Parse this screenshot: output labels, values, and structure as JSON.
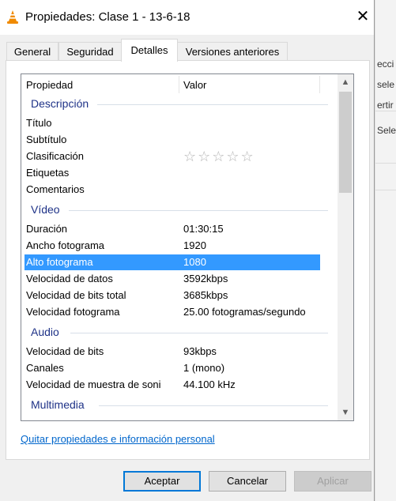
{
  "window": {
    "title": "Propiedades: Clase 1 - 13-6-18",
    "close_glyph": "✕"
  },
  "tabs": [
    {
      "label": "General"
    },
    {
      "label": "Seguridad"
    },
    {
      "label": "Detalles",
      "active": true
    },
    {
      "label": "Versiones anteriores"
    }
  ],
  "list": {
    "header": {
      "property": "Propiedad",
      "value": "Valor"
    },
    "groups": {
      "descripcion": "Descripción",
      "video": "Vídeo",
      "audio": "Audio",
      "multimedia": "Multimedia"
    },
    "rows": {
      "titulo": {
        "k": "Título",
        "v": ""
      },
      "subtitulo": {
        "k": "Subtítulo",
        "v": ""
      },
      "clasificacion": {
        "k": "Clasificación",
        "stars": "☆☆☆☆☆",
        "rating": 0
      },
      "etiquetas": {
        "k": "Etiquetas",
        "v": ""
      },
      "comentarios": {
        "k": "Comentarios",
        "v": ""
      },
      "duracion": {
        "k": "Duración",
        "v": "01:30:15"
      },
      "ancho": {
        "k": "Ancho fotograma",
        "v": "1920"
      },
      "alto": {
        "k": "Alto fotograma",
        "v": "1080",
        "selected": true
      },
      "vel_datos": {
        "k": "Velocidad de datos",
        "v": "3592kbps"
      },
      "vel_bits_total": {
        "k": "Velocidad de bits total",
        "v": "3685kbps"
      },
      "vel_fotograma": {
        "k": "Velocidad fotograma",
        "v": "25.00 fotogramas/segundo"
      },
      "vel_bits": {
        "k": "Velocidad de bits",
        "v": "93kbps"
      },
      "canales": {
        "k": "Canales",
        "v": "1 (mono)"
      },
      "vel_muestra": {
        "k": "Velocidad de muestra de soni",
        "v": "44.100 kHz"
      }
    }
  },
  "link": "Quitar propiedades e información personal",
  "buttons": {
    "ok": "Aceptar",
    "cancel": "Cancelar",
    "apply": "Aplicar"
  },
  "background_app": {
    "fragments": [
      "ecci",
      "sele",
      "ertir",
      "Sele"
    ]
  },
  "colors": {
    "selection": "#3399ff",
    "group_heading": "#1e3287",
    "link": "#0066cc",
    "default_button_border": "#0078d7"
  }
}
